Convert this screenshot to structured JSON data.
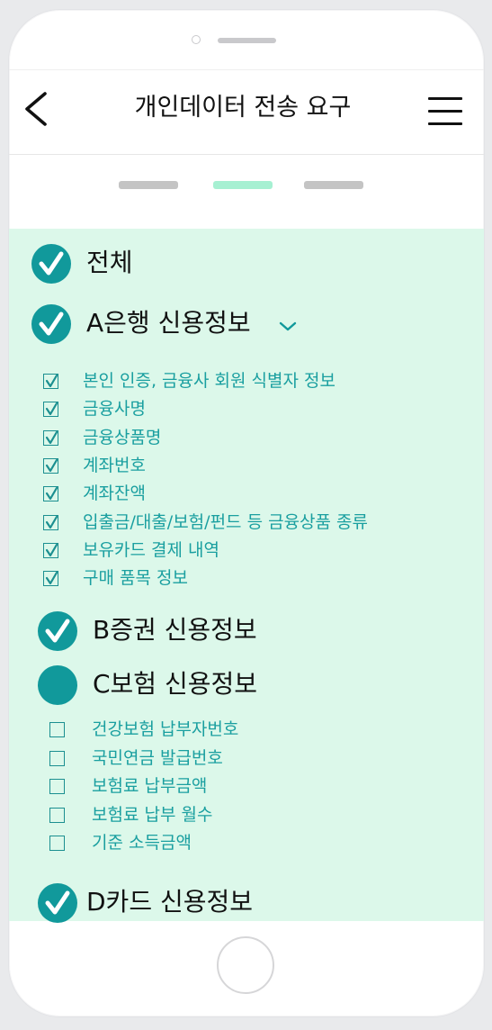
{
  "header": {
    "title": "개인데이터 전송 요구"
  },
  "steps": {
    "current": 2,
    "total": 3,
    "active_color": "#a6f0d2",
    "inactive_color": "#c4c4c4"
  },
  "colors": {
    "panel_bg": "#dcf8ea",
    "accent": "#11999b",
    "item_text": "#1a9fa0"
  },
  "all": {
    "label": "전체",
    "checked": true
  },
  "sections": [
    {
      "label": "A은행 신용정보",
      "checked": true,
      "expanded": true,
      "items": [
        {
          "label": "본인 인증, 금융사 회원 식별자 정보",
          "checked": true
        },
        {
          "label": "금융사명",
          "checked": true
        },
        {
          "label": "금융상품명",
          "checked": true
        },
        {
          "label": "계좌번호",
          "checked": true
        },
        {
          "label": "계좌잔액",
          "checked": true
        },
        {
          "label": "입출금/대출/보험/펀드 등 금융상품 종류",
          "checked": true
        },
        {
          "label": "보유카드 결제 내역",
          "checked": true
        },
        {
          "label": "구매 품목 정보",
          "checked": true
        }
      ]
    },
    {
      "label": "B증권 신용정보",
      "checked": true,
      "expanded": false,
      "items": []
    },
    {
      "label": "C보험 신용정보",
      "checked": false,
      "expanded": true,
      "items": [
        {
          "label": "건강보험 납부자번호",
          "checked": false
        },
        {
          "label": "국민연금 발급번호",
          "checked": false
        },
        {
          "label": "보험료 납부금액",
          "checked": false
        },
        {
          "label": "보험료 납부 월수",
          "checked": false
        },
        {
          "label": "기준 소득금액",
          "checked": false
        }
      ]
    },
    {
      "label": "D카드 신용정보",
      "checked": true,
      "expanded": false,
      "items": []
    }
  ]
}
